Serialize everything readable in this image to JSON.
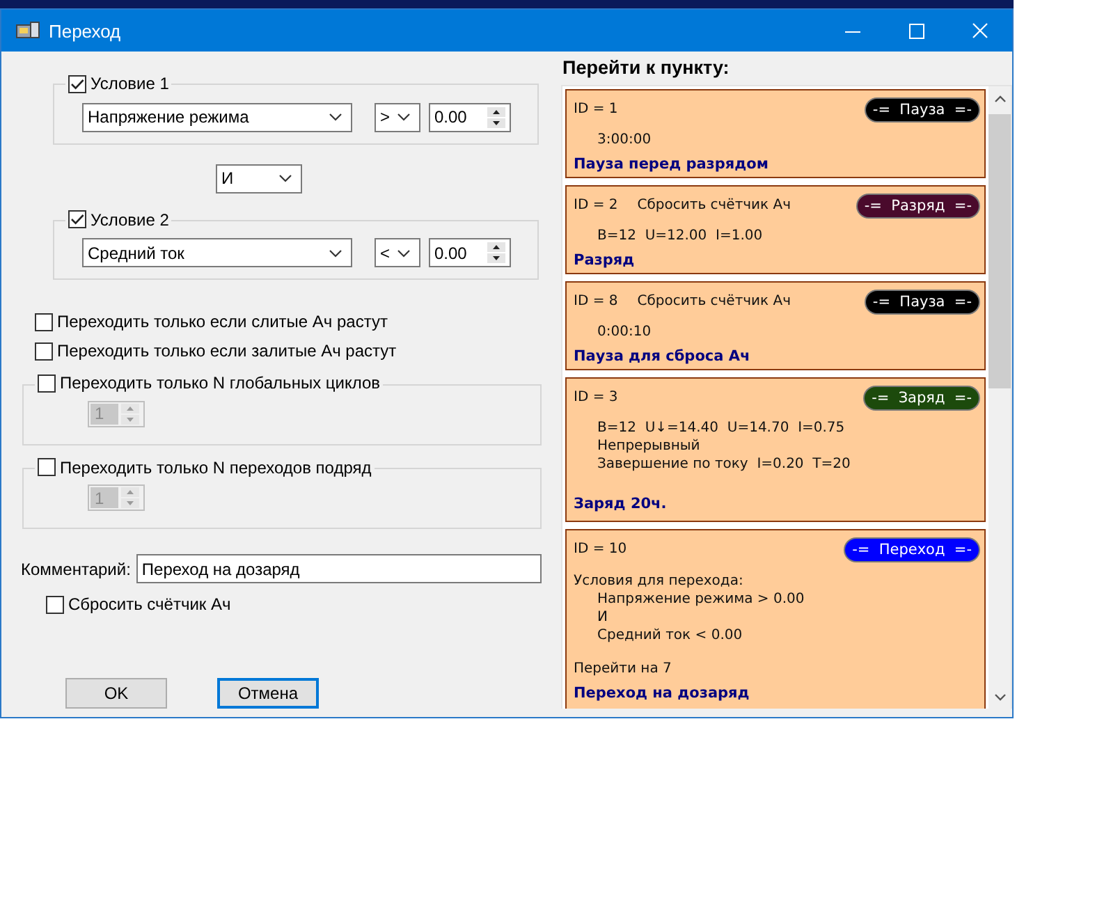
{
  "window": {
    "title": "Переход"
  },
  "conditions": [
    {
      "label": "Условие 1",
      "checked": true,
      "parameter": "Напряжение режима",
      "operator": ">",
      "value": "0.00"
    },
    {
      "label": "Условие 2",
      "checked": true,
      "parameter": "Средний ток",
      "operator": "<",
      "value": "0.00"
    }
  ],
  "logic": "И",
  "options": [
    {
      "label": "Переходить только если слитые Ач растут",
      "checked": false
    },
    {
      "label": "Переходить только если залитые Ач растут",
      "checked": false
    }
  ],
  "counters": [
    {
      "label": "Переходить только N глобальных циклов",
      "checked": false,
      "value": "1"
    },
    {
      "label": "Переходить только N переходов подряд",
      "checked": false,
      "value": "1"
    }
  ],
  "comment": {
    "label": "Комментарий:",
    "value": "Переход на дозаряд"
  },
  "reset_counter": {
    "label": "Сбросить счётчик Ач",
    "checked": false
  },
  "buttons": [
    {
      "label": "OK",
      "default": false
    },
    {
      "label": "Отмена",
      "default": true
    }
  ],
  "goto": {
    "title": "Перейти к пункту:",
    "items": [
      {
        "kind": "step",
        "id": "ID = 1",
        "badge": "-=  Пауза  =-",
        "color": "#000000",
        "details": [
          "3:00:00"
        ],
        "name": "Пауза перед разрядом"
      },
      {
        "kind": "step",
        "id": "ID = 2",
        "note": "Сбросить счётчик Ач",
        "badge": "-=  Разряд  =-",
        "color": "#4a0a2c",
        "details": [
          "B=12  U=12.00  I=1.00"
        ],
        "name": "Разряд"
      },
      {
        "kind": "step",
        "id": "ID = 8",
        "note": "Сбросить счётчик Ач",
        "badge": "-=  Пауза  =-",
        "color": "#000000",
        "details": [
          "0:00:10"
        ],
        "name": "Пауза для сброса Ач"
      },
      {
        "kind": "step",
        "id": "ID = 3",
        "badge": "-=  Заряд  =-",
        "color": "#1c4a0c",
        "details": [
          "B=12  U↓=14.40  U=14.70  I=0.75",
          "Непрерывный",
          "Завершение по току  I=0.20  T=20"
        ],
        "name": "Заряд 20ч."
      },
      {
        "kind": "transition",
        "id": "ID = 10",
        "badge": "-=  Переход  =-",
        "color": "#0000ff",
        "conditions_title": "Условия для перехода:",
        "conditions": [
          "Напряжение режима > 0.00",
          "И",
          "Средний ток < 0.00"
        ],
        "goto": "Перейти на 7",
        "name": "Переход на дозаряд"
      }
    ]
  }
}
